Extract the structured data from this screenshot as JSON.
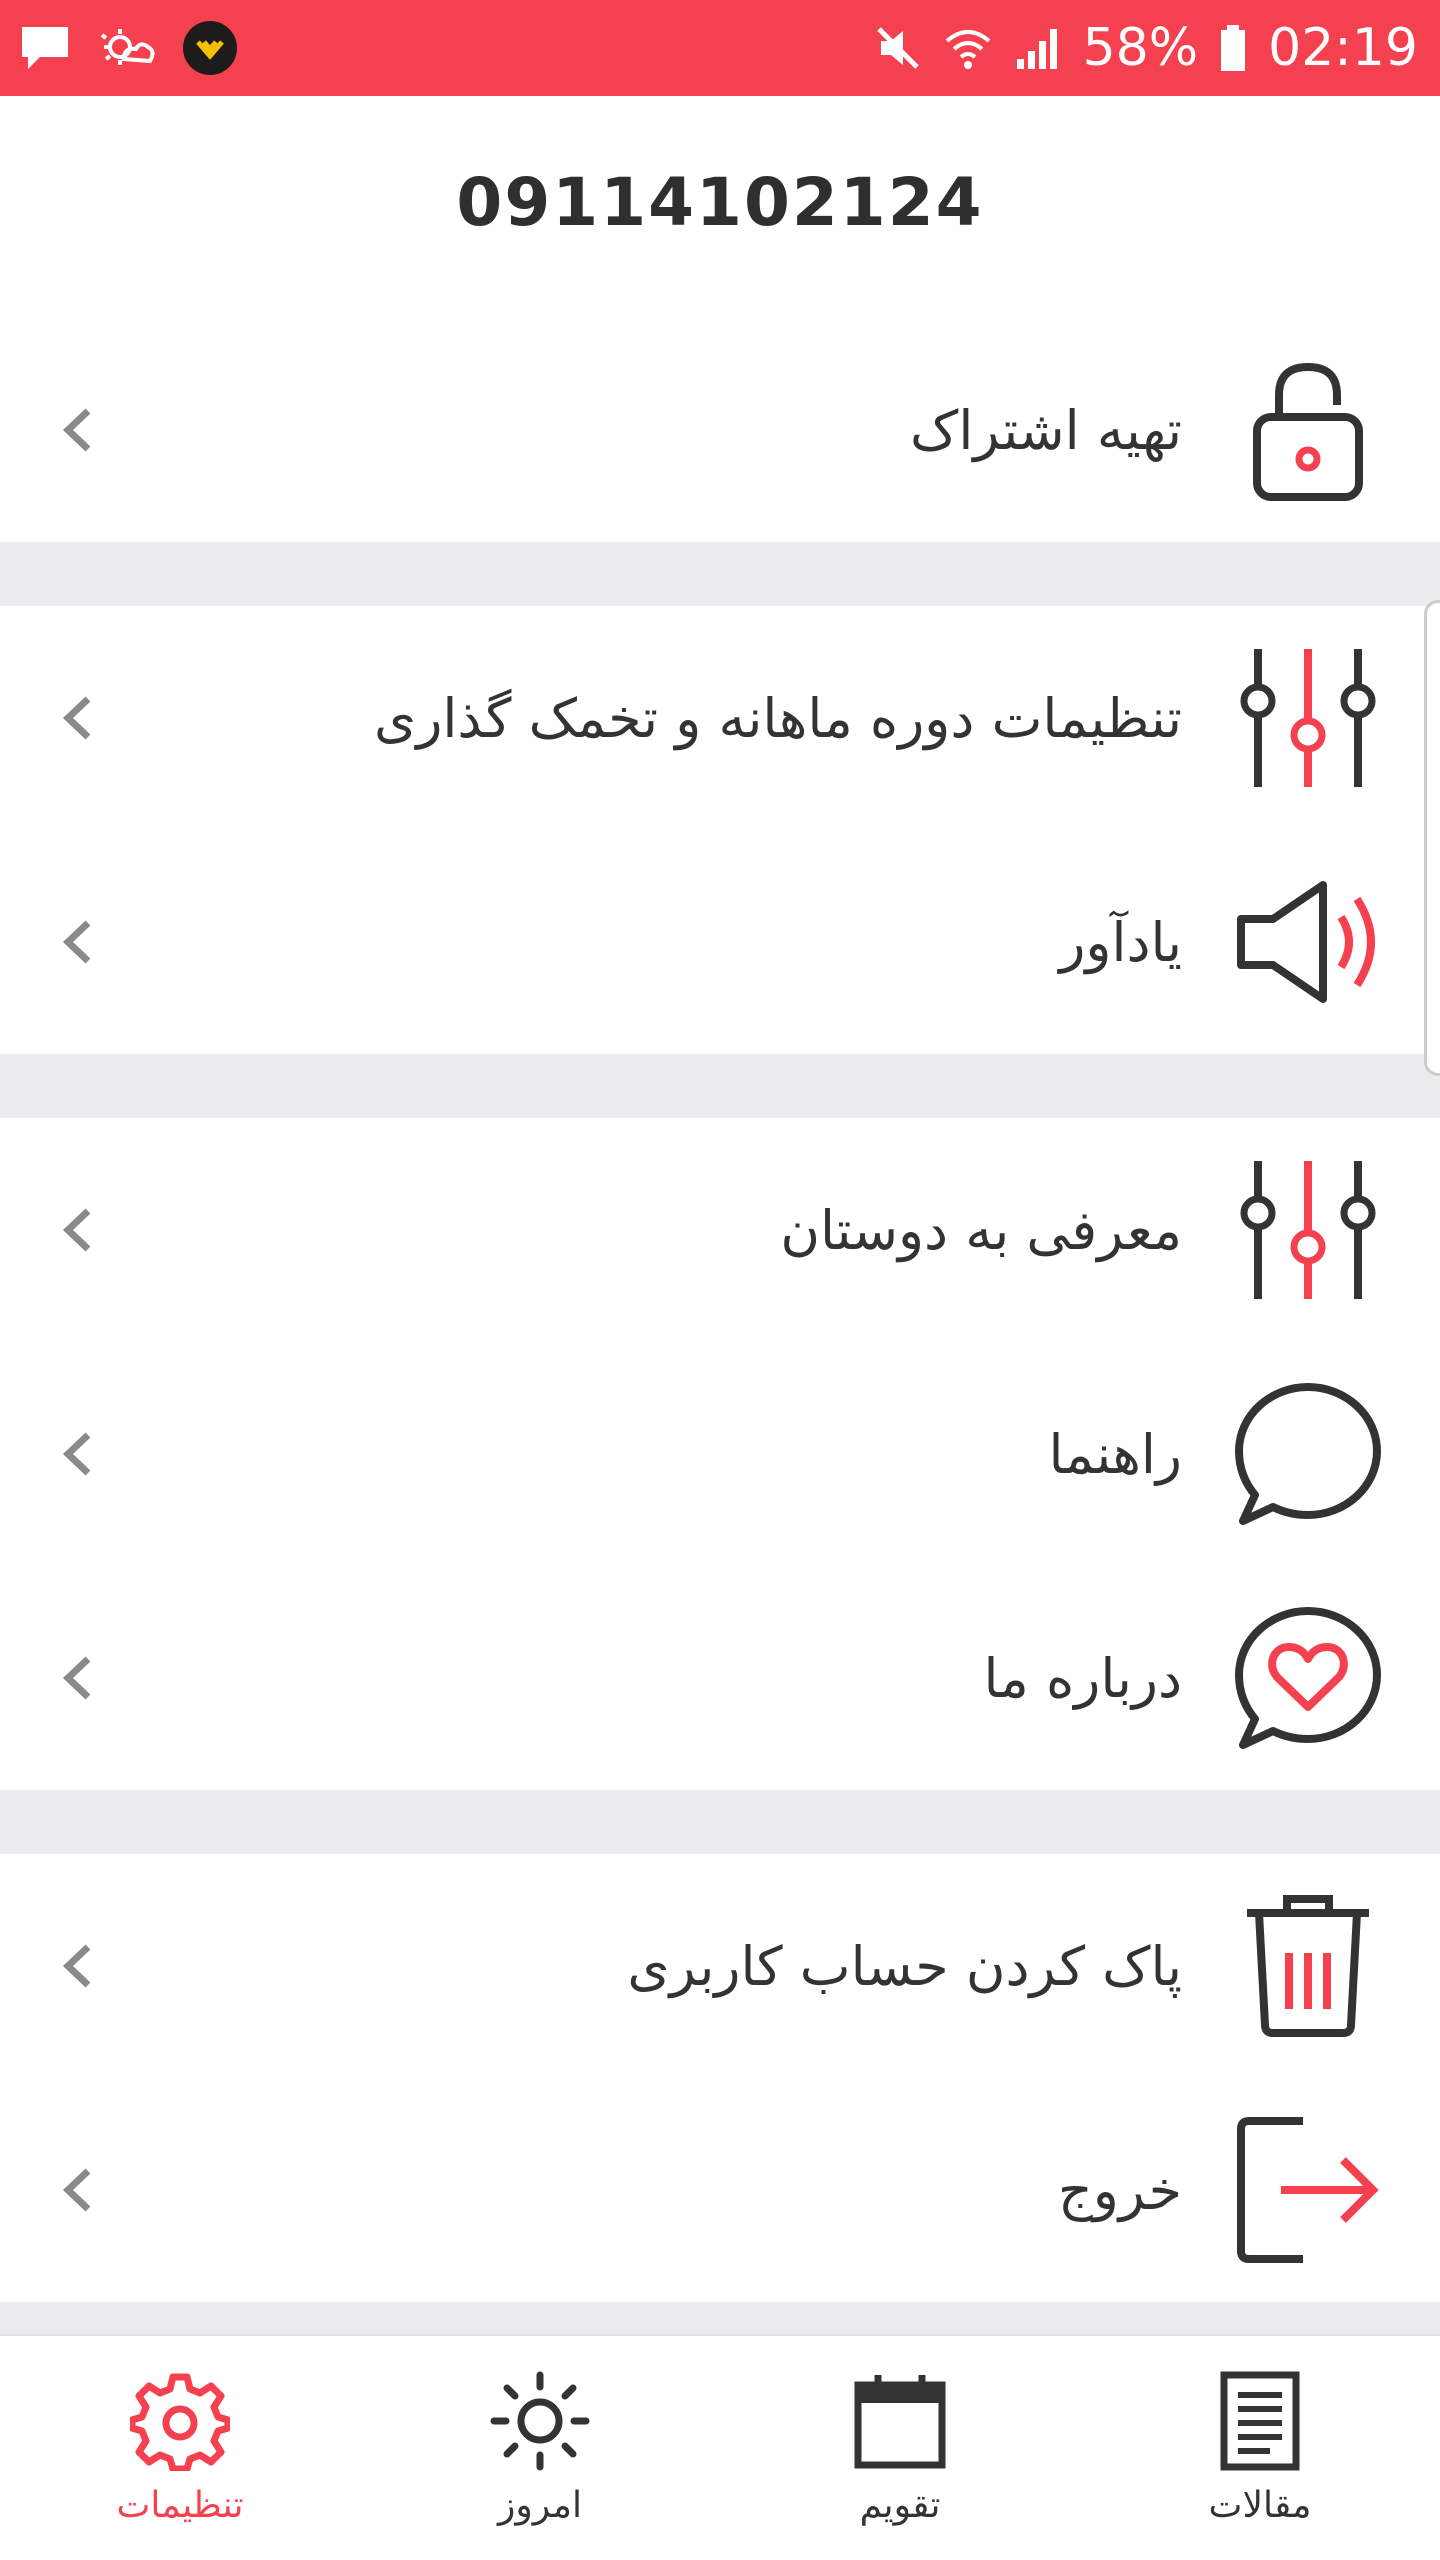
{
  "status_bar": {
    "battery_percent": "58%",
    "time": "02:19",
    "bg_color": "#f4404f"
  },
  "header": {
    "phone": "09114102124"
  },
  "accent_color": "#f4404f",
  "groups": [
    {
      "items": [
        {
          "label": "تهیه اشتراک",
          "icon": "lock-icon"
        }
      ]
    },
    {
      "items": [
        {
          "label": "تنظیمات دوره ماهانه و تخمک گذاری",
          "icon": "sliders-icon"
        },
        {
          "label": "یادآور",
          "icon": "speaker-icon"
        }
      ]
    },
    {
      "items": [
        {
          "label": "معرفی به دوستان",
          "icon": "sliders-icon"
        },
        {
          "label": "راهنما",
          "icon": "chat-bubble-icon"
        },
        {
          "label": "درباره ما",
          "icon": "heart-bubble-icon"
        }
      ]
    },
    {
      "items": [
        {
          "label": "پاک کردن حساب کاربری",
          "icon": "trash-icon"
        },
        {
          "label": "خروج",
          "icon": "logout-icon"
        }
      ]
    }
  ],
  "bottom_nav": [
    {
      "label": "تنظیمات",
      "icon": "gear-icon",
      "active": true
    },
    {
      "label": "امروز",
      "icon": "sun-icon",
      "active": false
    },
    {
      "label": "تقویم",
      "icon": "calendar-icon",
      "active": false
    },
    {
      "label": "مقالات",
      "icon": "article-icon",
      "active": false
    }
  ]
}
